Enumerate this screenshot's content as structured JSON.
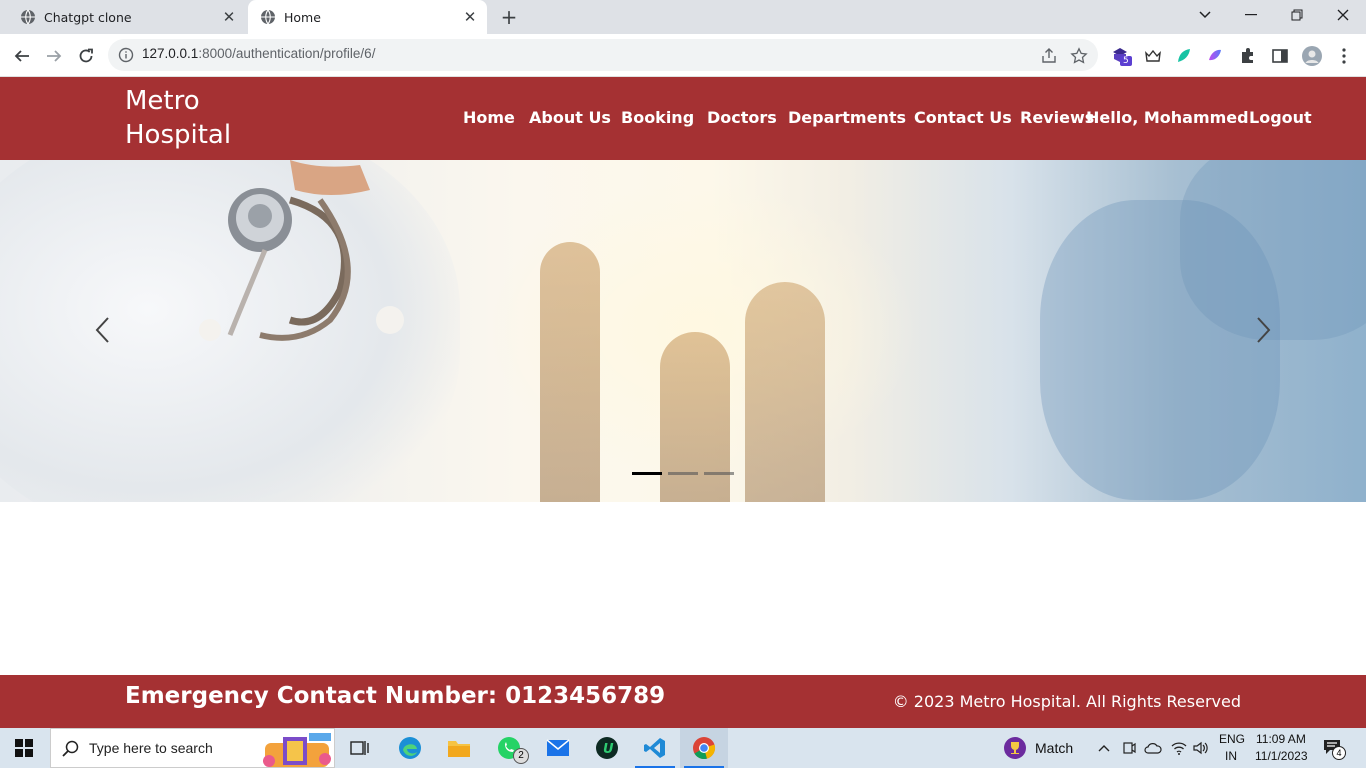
{
  "browser": {
    "tabs": [
      {
        "title": "Chatgpt clone",
        "active": false
      },
      {
        "title": "Home",
        "active": true
      }
    ],
    "url_host": "127.0.0.1",
    "url_rest": ":8000/authentication/profile/6/",
    "extension_badge": "5"
  },
  "site": {
    "brand_line1": "Metro",
    "brand_line2": "Hospital",
    "nav": {
      "home": "Home",
      "about": "About Us",
      "booking": "Booking",
      "doctors": "Doctors",
      "departments": "Departments",
      "contact": "Contact Us",
      "reviews": "Reviews",
      "greeting": "Hello, Mohammed",
      "logout": "Logout"
    },
    "carousel": {
      "slides": 3,
      "active_index": 0
    },
    "footer": {
      "emergency": "Emergency Contact Number: 0123456789",
      "copyright": "© 2023 Metro Hospital. All Rights Reserved"
    },
    "colors": {
      "brand": "#a53133"
    }
  },
  "taskbar": {
    "search_placeholder": "Type here to search",
    "whatsapp_badge": "2",
    "weather_label": "Match",
    "lang_line1": "ENG",
    "lang_line2": "IN",
    "time": "11:09 AM",
    "date": "11/1/2023",
    "notification_count": "4"
  }
}
